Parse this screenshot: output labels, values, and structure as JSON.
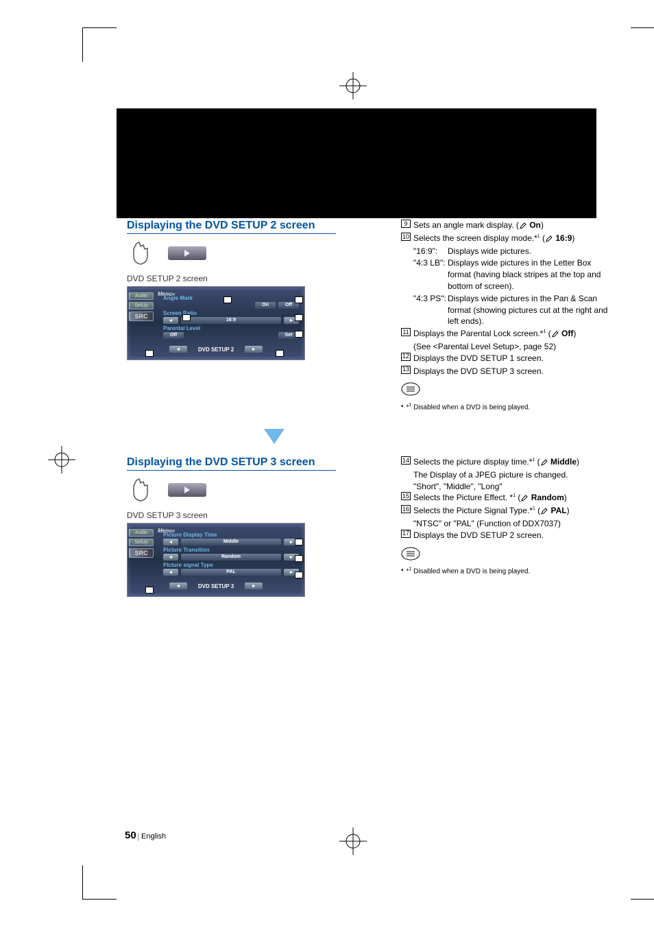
{
  "page": {
    "number": "50",
    "language": "English"
  },
  "section1": {
    "heading": "Displaying the DVD SETUP 2 screen",
    "screenLabel": "DVD SETUP 2 screen",
    "screen": {
      "tabs": {
        "audio": "Audio",
        "setup": "SetUp",
        "src": "SRC"
      },
      "menuWord": "Menu",
      "rows": {
        "angleMark": {
          "label": "Angle Mark",
          "on": "On",
          "off": "Off"
        },
        "screenRatio": {
          "label": "Screen Ratio",
          "value": "16:9"
        },
        "parentalLevel": {
          "label": "Parental Level",
          "value": "Off",
          "set": "Set"
        }
      },
      "footerTitle": "DVD SETUP 2"
    },
    "right": {
      "i9": {
        "num": "9",
        "text": "Sets an angle mark display. (",
        "default": " On",
        "tail": ")"
      },
      "i10": {
        "num": "10",
        "text": "Selects the screen display mode.*",
        "sup": "1",
        "pre": " (",
        "default": " 16:9",
        "tail": ")"
      },
      "d1": {
        "term": "\"16:9\":",
        "desc": "Displays wide pictures."
      },
      "d2": {
        "term": "\"4:3 LB\":",
        "desc": "Displays wide pictures in the Letter Box format (having black stripes at the top and bottom of screen)."
      },
      "d3": {
        "term": "\"4:3 PS\":",
        "desc": "Displays wide pictures in the Pan & Scan format (showing pictures cut at the right and left ends)."
      },
      "i11": {
        "num": "11",
        "text": "Displays the Parental Lock screen.*",
        "sup": "1",
        "pre": " (",
        "default": " Off",
        "tail": ")"
      },
      "i11b": "(See <Parental Level Setup>, page 52)",
      "i12": {
        "num": "12",
        "text": "Displays the DVD SETUP 1 screen."
      },
      "i13": {
        "num": "13",
        "text": "Displays the DVD SETUP 3 screen."
      },
      "note": {
        "bullet": "•",
        "star": "*",
        "sup": "1",
        "text": " Disabled when a DVD is being played."
      }
    }
  },
  "section2": {
    "heading": "Displaying the DVD SETUP 3 screen",
    "screenLabel": "DVD SETUP 3 screen",
    "screen": {
      "tabs": {
        "audio": "Audio",
        "setup": "SetUp",
        "src": "SRC"
      },
      "menuWord": "Menu",
      "rows": {
        "pdt": {
          "label": "Picture Display Time",
          "value": "Middle"
        },
        "pt": {
          "label": "Picture Transition",
          "value": "Random"
        },
        "pst": {
          "label": "Picture signal Type",
          "value": "PAL"
        }
      },
      "footerTitle": "DVD SETUP 3"
    },
    "right": {
      "i14": {
        "num": "14",
        "text": "Selects the picture display time.*",
        "sup": "1",
        "pre": " (",
        "default": " Middle",
        "tail": ")"
      },
      "i14b": "The Display of a JPEG picture is changed.",
      "i14c": "\"Short\", \"Middle\", \"Long\"",
      "i15": {
        "num": "15",
        "text": "Selects the Picture Effect. *",
        "sup": "1",
        "pre": " (",
        "default": " Random",
        "tail": ")"
      },
      "i16": {
        "num": "16",
        "text": "Selects the Picture Signal Type.*",
        "sup": "1",
        "pre": " (",
        "default": " PAL",
        "tail": ")"
      },
      "i16b": "\"NTSC\" or \"PAL\" (Function of DDX7037)",
      "i17": {
        "num": "17",
        "text": "Displays the DVD SETUP 2 screen."
      },
      "note": {
        "bullet": "•",
        "star": "*",
        "sup": "1",
        "text": " Disabled when a DVD is being played."
      }
    }
  }
}
